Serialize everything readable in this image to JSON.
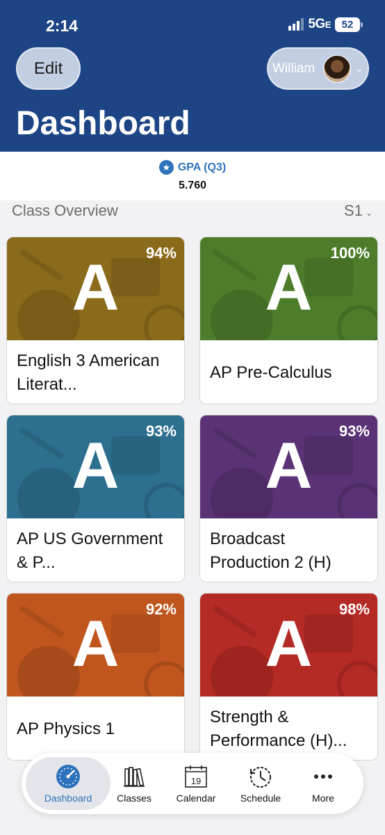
{
  "status": {
    "time": "2:14",
    "network": "5G",
    "network_suffix": "E",
    "battery": "52"
  },
  "header": {
    "edit_label": "Edit",
    "user_name": "William",
    "title": "Dashboard"
  },
  "gpa": {
    "label": "GPA (Q3)",
    "value": "5.760"
  },
  "overview": {
    "title": "Class Overview",
    "term": "S1"
  },
  "classes": [
    {
      "name": "English 3 American Literat...",
      "grade": "A",
      "percent": "94%",
      "color": "#8a6a1b"
    },
    {
      "name": "AP Pre-Calculus",
      "grade": "A",
      "percent": "100%",
      "color": "#4d7d2a"
    },
    {
      "name": "AP US Government & P...",
      "grade": "A",
      "percent": "93%",
      "color": "#2d6f8f"
    },
    {
      "name": "Broadcast Production 2 (H)",
      "grade": "A",
      "percent": "93%",
      "color": "#5a3275"
    },
    {
      "name": "AP Physics 1",
      "grade": "A",
      "percent": "92%",
      "color": "#c0561e"
    },
    {
      "name": "Strength & Performance (H)...",
      "grade": "A",
      "percent": "98%",
      "color": "#b42a24"
    }
  ],
  "tabs": [
    {
      "label": "Dashboard",
      "icon": "dashboard-gauge-icon"
    },
    {
      "label": "Classes",
      "icon": "books-icon"
    },
    {
      "label": "Calendar",
      "icon": "calendar-icon",
      "day": "19"
    },
    {
      "label": "Schedule",
      "icon": "clock-history-icon"
    },
    {
      "label": "More",
      "icon": "more-dots-icon"
    }
  ],
  "colors": {
    "header": "#1d4585",
    "accent": "#2d72bb"
  }
}
